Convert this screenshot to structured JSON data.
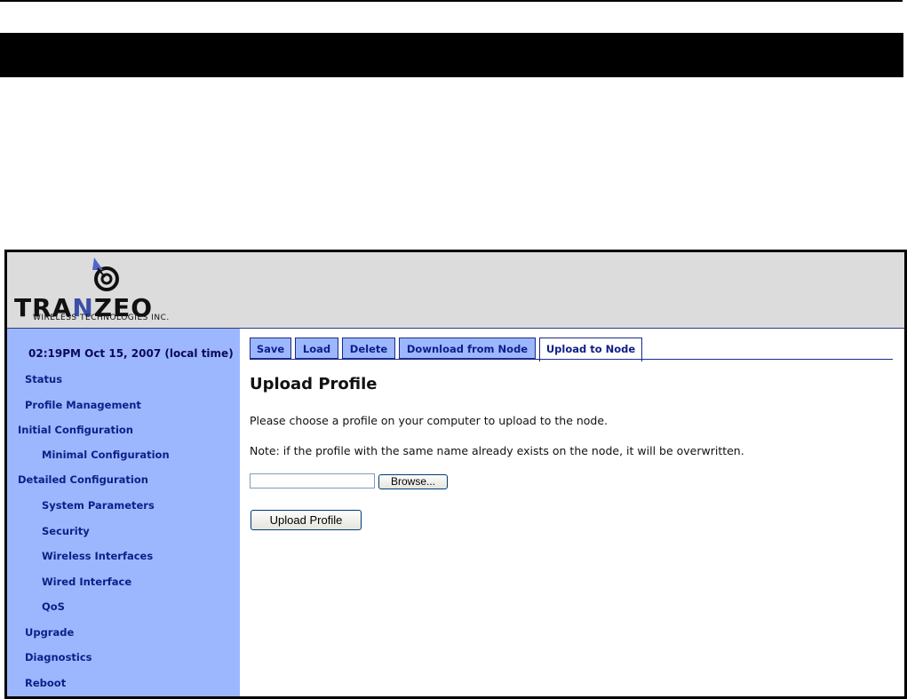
{
  "brand": {
    "logo_text_left": "TRA",
    "logo_text_n": "N",
    "logo_text_right": "ZEO",
    "logo_subtitle": "WIRELESS TECHNOLOGIES INC.",
    "accent_color": "#3a4fa8",
    "sidebar_color": "#9db7ff"
  },
  "sidebar": {
    "time": "02:19PM Oct 15, 2007 (local time)",
    "items": [
      {
        "label": "Status"
      },
      {
        "label": "Profile Management"
      },
      {
        "label": "Initial Configuration"
      },
      {
        "label": "Minimal Configuration"
      },
      {
        "label": "Detailed Configuration"
      },
      {
        "label": "System Parameters"
      },
      {
        "label": "Security"
      },
      {
        "label": "Wireless Interfaces"
      },
      {
        "label": "Wired Interface"
      },
      {
        "label": "QoS"
      },
      {
        "label": "Upgrade"
      },
      {
        "label": "Diagnostics"
      },
      {
        "label": "Reboot"
      }
    ]
  },
  "tabs": [
    {
      "label": "Save"
    },
    {
      "label": "Load"
    },
    {
      "label": "Delete"
    },
    {
      "label": "Download from Node"
    },
    {
      "label": "Upload to Node",
      "active": true
    }
  ],
  "main": {
    "title": "Upload Profile",
    "instruction": "Please choose a profile on your computer to upload to the node.",
    "note": "Note: if the profile with the same name already exists on the node, it will be overwritten.",
    "file_value": "",
    "browse_label": "Browse...",
    "upload_label": "Upload Profile"
  }
}
